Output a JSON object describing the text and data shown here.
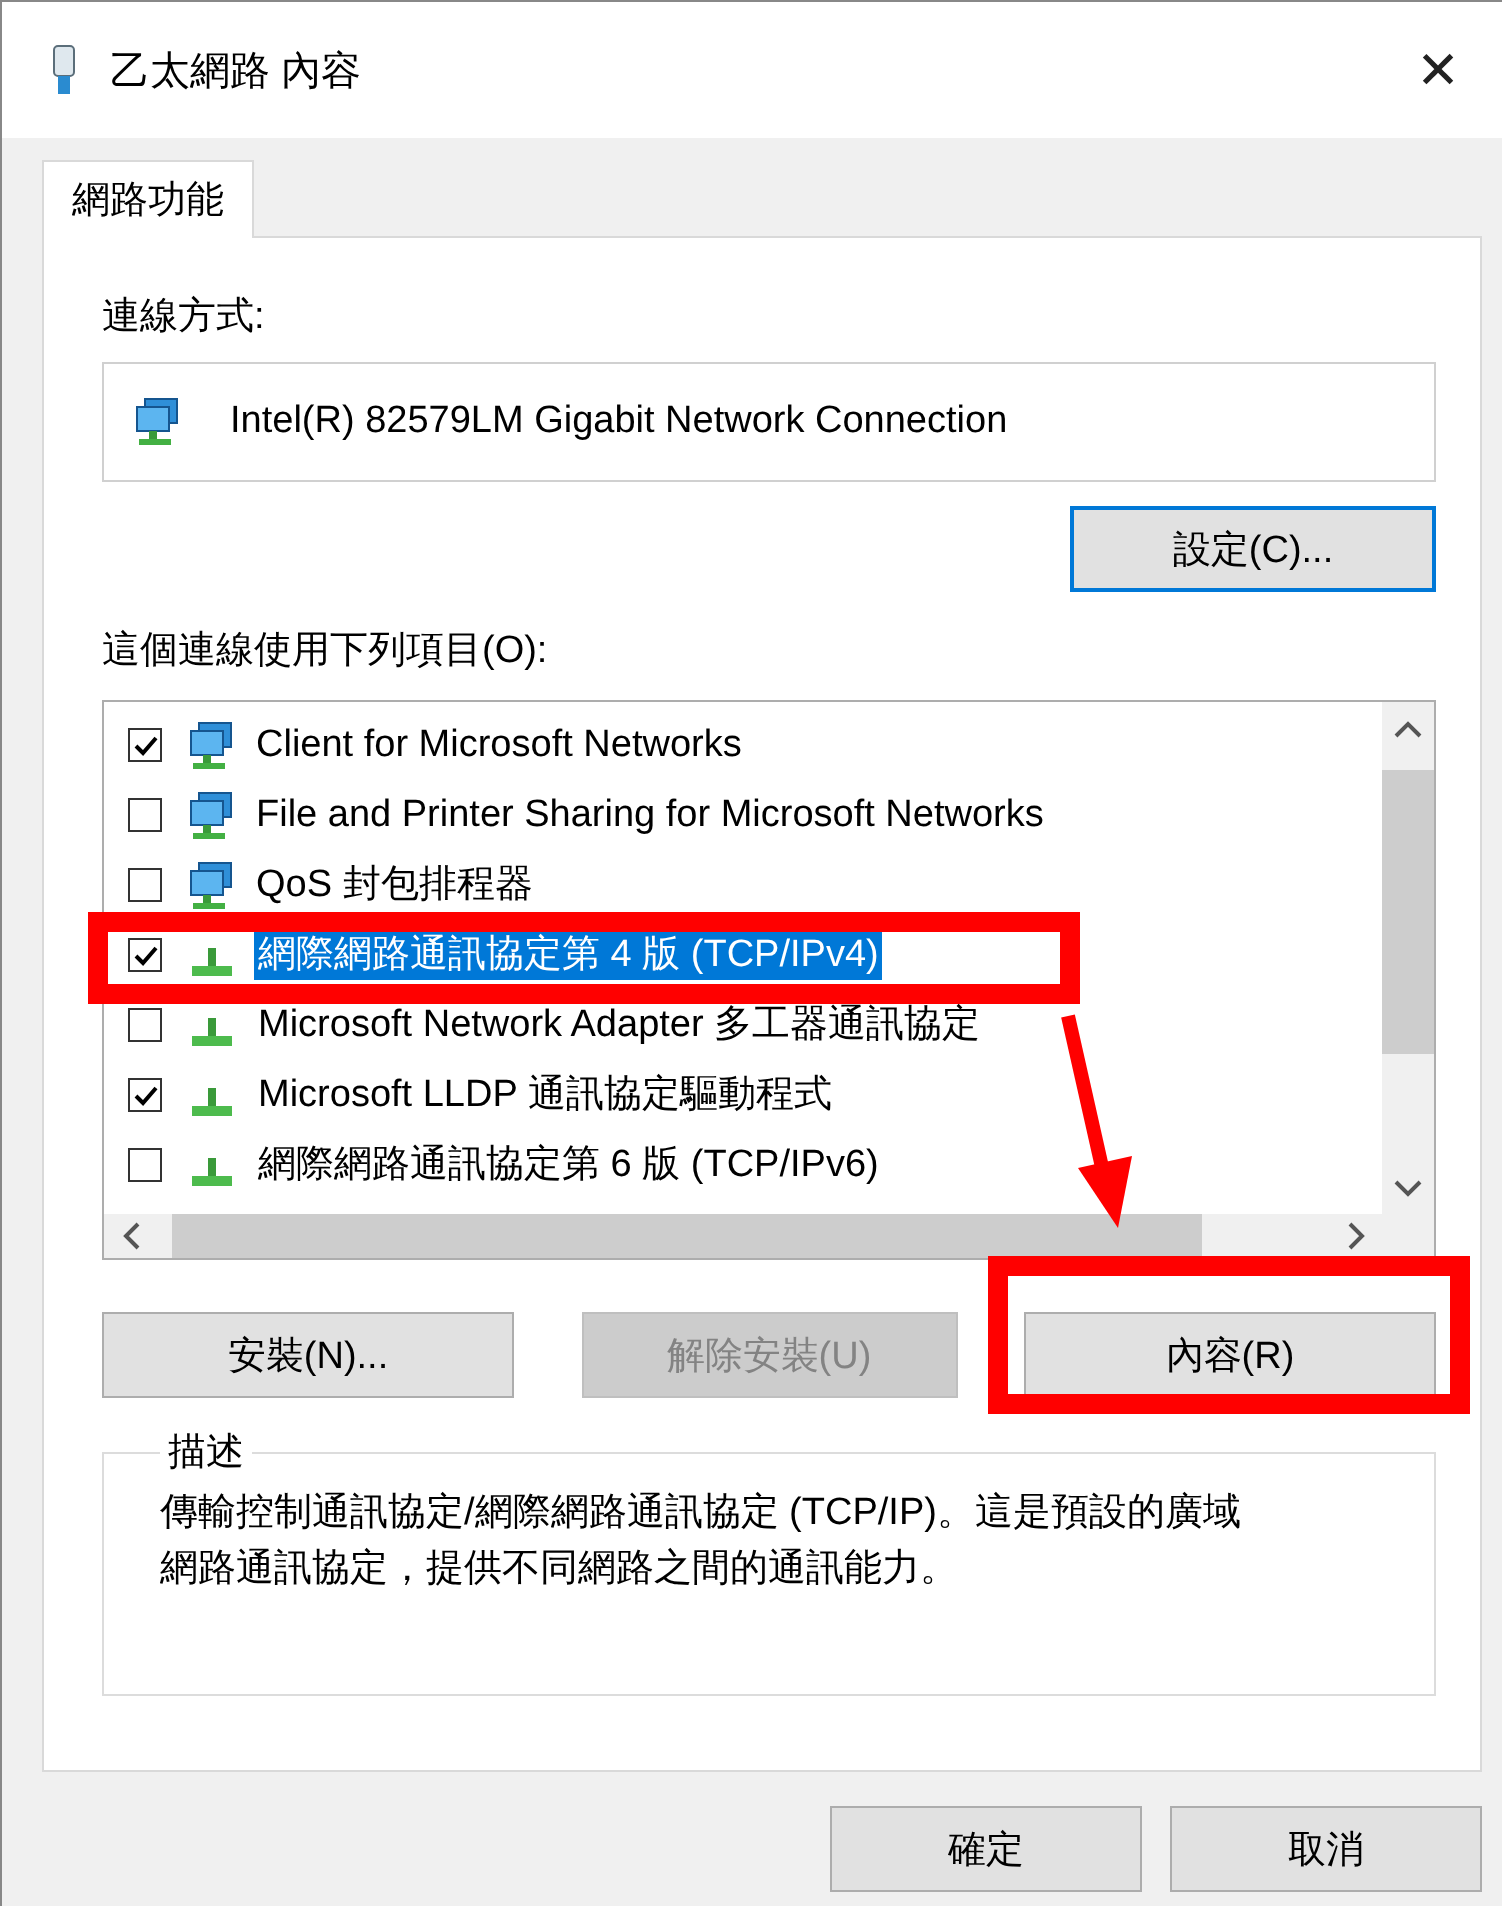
{
  "window": {
    "title": "乙太網路 內容",
    "close": "✕"
  },
  "tabs": [
    {
      "label": "網路功能",
      "selected": true
    }
  ],
  "connect_using": {
    "label": "連線方式:",
    "adapter": "Intel(R) 82579LM Gigabit Network Connection",
    "configure_button": "設定(C)..."
  },
  "items_label": "這個連線使用下列項目(O):",
  "items": [
    {
      "kind": "client",
      "label": "Client for Microsoft Networks",
      "checked": true,
      "selected": false
    },
    {
      "kind": "client",
      "label": "File and Printer Sharing for Microsoft Networks",
      "checked": false,
      "selected": false
    },
    {
      "kind": "client",
      "label": "QoS 封包排程器",
      "checked": false,
      "selected": false
    },
    {
      "kind": "protocol",
      "label": "網際網路通訊協定第 4 版 (TCP/IPv4)",
      "checked": true,
      "selected": true
    },
    {
      "kind": "protocol",
      "label": "Microsoft Network Adapter 多工器通訊協定",
      "checked": false,
      "selected": false
    },
    {
      "kind": "protocol",
      "label": "Microsoft LLDP 通訊協定驅動程式",
      "checked": true,
      "selected": false
    },
    {
      "kind": "protocol",
      "label": "網際網路通訊協定第 6 版 (TCP/IPv6)",
      "checked": false,
      "selected": false
    }
  ],
  "item_buttons": [
    {
      "label": "安裝(N)...",
      "disabled": false
    },
    {
      "label": "解除安裝(U)",
      "disabled": true
    },
    {
      "label": "內容(R)",
      "disabled": false
    }
  ],
  "description": {
    "title": "描述",
    "text": "傳輸控制通訊協定/網際網路通訊協定 (TCP/IP)。這是預設的廣域網路通訊協定，提供不同網路之間的通訊能力。"
  },
  "dialog_buttons": [
    "確定",
    "取消"
  ],
  "annotations": [
    {
      "kind": "box"
    },
    {
      "kind": "box"
    },
    {
      "kind": "arrow"
    }
  ]
}
